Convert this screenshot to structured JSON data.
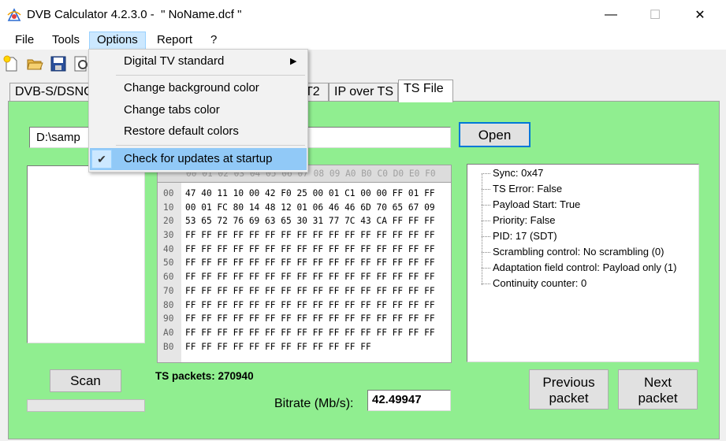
{
  "window": {
    "title": "DVB Calculator 4.2.3.0 -  \" NoName.dcf \"",
    "minimize_glyph": "—",
    "maximize_glyph": "☐",
    "close_glyph": "✕"
  },
  "menubar": {
    "items": [
      "File",
      "Tools",
      "Options",
      "Report",
      "?"
    ]
  },
  "toolbar": {
    "icons": [
      "new-file-icon",
      "open-folder-icon",
      "save-icon",
      "print-preview-icon"
    ]
  },
  "tabs": {
    "items": [
      "DVB-S/DSNG",
      "T2",
      "IP over TS",
      "TS File"
    ],
    "active": "TS File"
  },
  "options_menu": {
    "digital_tv_standard": "Digital TV standard",
    "submenu_arrow": "▶",
    "change_background_color": "Change background color",
    "change_tabs_color": "Change tabs color",
    "restore_default_colors": "Restore default colors",
    "check_for_updates": "Check for updates at startup",
    "check_for_updates_checked": true,
    "check_glyph": "✔"
  },
  "ts_file": {
    "path_value": "D:\\samp",
    "open_label": "Open",
    "hex_header": "00 01 02 03 04 05 06 07 08 09 A0 B0 C0 D0 E0 F0",
    "hex_offsets": [
      "00",
      "10",
      "20",
      "30",
      "40",
      "50",
      "60",
      "70",
      "80",
      "90",
      "A0",
      "B0"
    ],
    "hex_rows": [
      "47 40 11 10 00 42 F0 25 00 01 C1 00 00 FF 01 FF",
      "00 01 FC 80 14 48 12 01 06 46 46 6D 70 65 67 09",
      "53 65 72 76 69 63 65 30 31 77 7C 43 CA FF FF FF",
      "FF FF FF FF FF FF FF FF FF FF FF FF FF FF FF FF",
      "FF FF FF FF FF FF FF FF FF FF FF FF FF FF FF FF",
      "FF FF FF FF FF FF FF FF FF FF FF FF FF FF FF FF",
      "FF FF FF FF FF FF FF FF FF FF FF FF FF FF FF FF",
      "FF FF FF FF FF FF FF FF FF FF FF FF FF FF FF FF",
      "FF FF FF FF FF FF FF FF FF FF FF FF FF FF FF FF",
      "FF FF FF FF FF FF FF FF FF FF FF FF FF FF FF FF",
      "FF FF FF FF FF FF FF FF FF FF FF FF FF FF FF FF",
      "FF FF FF FF FF FF FF FF FF FF FF FF"
    ],
    "packet_info": [
      "Sync: 0x47",
      "TS Error: False",
      "Payload Start: True",
      "Priority: False",
      "PID: 17 (SDT)",
      "Scrambling control: No scrambling (0)",
      "Adaptation field control: Payload only (1)",
      "Continuity counter: 0"
    ],
    "scan_label": "Scan",
    "scan_progress": 0,
    "ts_packets_label": "TS packets: 270940",
    "bitrate_label": "Bitrate (Mb/s):",
    "bitrate_value": "42.49947",
    "previous_packet_label": [
      "Previous",
      "packet"
    ],
    "next_packet_label": [
      "Next",
      "packet"
    ]
  },
  "colors": {
    "panel_background": "#90ee90",
    "window_background": "#f0f0f0",
    "open_button_border": "#0078d7"
  }
}
